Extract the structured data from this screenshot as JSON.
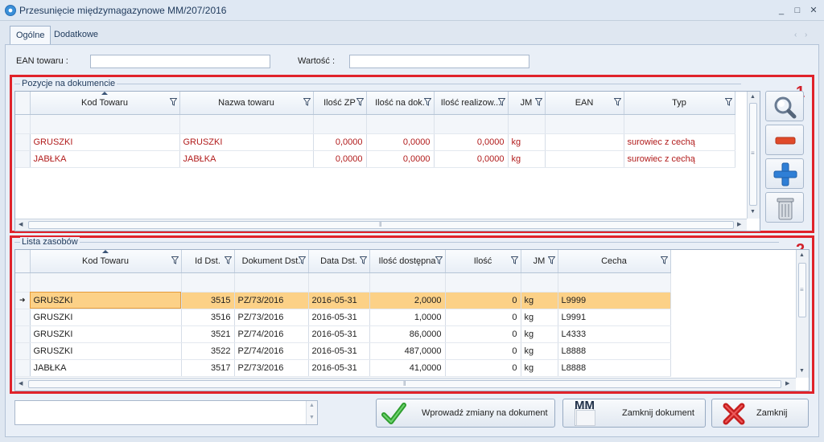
{
  "window": {
    "title": "Przesunięcie międzymagazynowe  MM/207/2016",
    "controls": [
      "_",
      "□",
      "✕"
    ]
  },
  "tabs": [
    {
      "label": "Ogólne",
      "active": true
    },
    {
      "label": "Dodatkowe",
      "active": false
    }
  ],
  "tab_nav": [
    "‹",
    "›"
  ],
  "fields": {
    "ean_label": "EAN towaru :",
    "ean_value": "",
    "wartosc_label": "Wartość :",
    "wartosc_value": ""
  },
  "positions": {
    "title": "Pozycje na dokumencie",
    "marker": "1",
    "columns": [
      "Kod Towaru",
      "Nazwa towaru",
      "Ilość ZP",
      "Ilość na dok.",
      "Ilość realizow...",
      "JM",
      "EAN",
      "Typ"
    ],
    "rows": [
      {
        "kod": "GRUSZKI",
        "nazwa": "GRUSZKI",
        "ilosc_zp": "0,0000",
        "ilosc_dok": "0,0000",
        "ilosc_real": "0,0000",
        "jm": "kg",
        "ean": "",
        "typ": "surowiec z cechą"
      },
      {
        "kod": "JABŁKA",
        "nazwa": "JABŁKA",
        "ilosc_zp": "0,0000",
        "ilosc_dok": "0,0000",
        "ilosc_real": "0,0000",
        "jm": "kg",
        "ean": "",
        "typ": "surowiec z cechą"
      }
    ]
  },
  "resources": {
    "title": "Lista zasobów",
    "marker": "2",
    "columns": [
      "Kod Towaru",
      "Id Dst.",
      "Dokument Dst.",
      "Data Dst.",
      "Ilość dostępna",
      "Ilość",
      "JM",
      "Cecha"
    ],
    "rows": [
      {
        "kod": "GRUSZKI",
        "id": "3515",
        "dok": "PZ/73/2016",
        "data": "2016-05-31",
        "dost": "2,0000",
        "ilosc": "0",
        "jm": "kg",
        "cecha": "L9999",
        "selected": true
      },
      {
        "kod": "GRUSZKI",
        "id": "3516",
        "dok": "PZ/73/2016",
        "data": "2016-05-31",
        "dost": "1,0000",
        "ilosc": "0",
        "jm": "kg",
        "cecha": "L9991"
      },
      {
        "kod": "GRUSZKI",
        "id": "3521",
        "dok": "PZ/74/2016",
        "data": "2016-05-31",
        "dost": "86,0000",
        "ilosc": "0",
        "jm": "kg",
        "cecha": "L4333"
      },
      {
        "kod": "GRUSZKI",
        "id": "3522",
        "dok": "PZ/74/2016",
        "data": "2016-05-31",
        "dost": "487,0000",
        "ilosc": "0",
        "jm": "kg",
        "cecha": "L8888"
      },
      {
        "kod": "JABŁKA",
        "id": "3517",
        "dok": "PZ/73/2016",
        "data": "2016-05-31",
        "dost": "41,0000",
        "ilosc": "0",
        "jm": "kg",
        "cecha": "L8888"
      }
    ]
  },
  "side_buttons": [
    "magnifier-icon",
    "minus-icon",
    "plus-icon",
    "trash-icon"
  ],
  "actions": {
    "apply_label": "Wprowadź zmiany na dokument",
    "close_doc_label": "Zamknij dokument",
    "close_doc_icon_text": "MM",
    "close_label": "Zamknij"
  },
  "colors": {
    "highlight": "#e0222a",
    "selected_row": "#fcd187",
    "red_text": "#b11b1b"
  }
}
